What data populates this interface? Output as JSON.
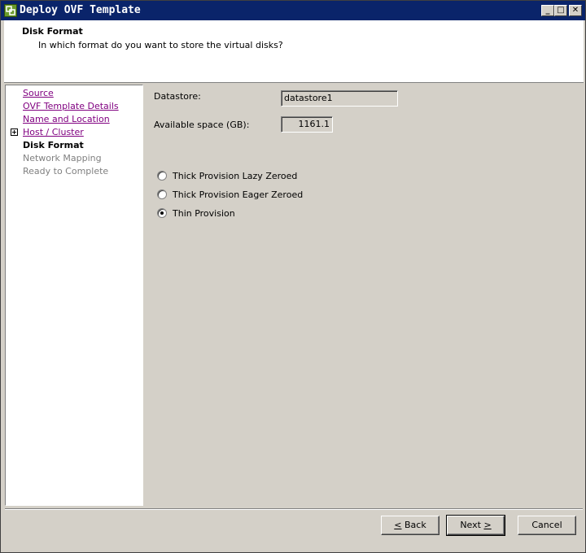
{
  "window": {
    "title": "Deploy OVF Template",
    "minimize_glyph": "_",
    "maximize_glyph": "□",
    "close_glyph": "✕"
  },
  "header": {
    "title": "Disk Format",
    "subtitle": "In which format do you want to store the virtual disks?"
  },
  "sidebar": {
    "items": [
      {
        "label": "Source",
        "state": "link"
      },
      {
        "label": "OVF Template Details",
        "state": "link"
      },
      {
        "label": "Name and Location",
        "state": "link"
      },
      {
        "label": "Host / Cluster",
        "state": "link"
      },
      {
        "label": "Disk Format",
        "state": "current"
      },
      {
        "label": "Network Mapping",
        "state": "disabled"
      },
      {
        "label": "Ready to Complete",
        "state": "disabled"
      }
    ]
  },
  "form": {
    "datastore_label": "Datastore:",
    "datastore_value": "datastore1",
    "available_label": "Available space (GB):",
    "available_value": "1161.1",
    "options": [
      {
        "label": "Thick Provision Lazy Zeroed",
        "checked": false
      },
      {
        "label": "Thick Provision Eager Zeroed",
        "checked": false
      },
      {
        "label": "Thin Provision",
        "checked": true
      }
    ]
  },
  "buttons": {
    "back_accel": "<",
    "back_rest": " Back",
    "next_text": "Next ",
    "next_accel": ">",
    "cancel": "Cancel"
  },
  "colors": {
    "titlebar": "#0a246a",
    "visited_link": "#800080",
    "dialog_face": "#d4d0c8"
  }
}
